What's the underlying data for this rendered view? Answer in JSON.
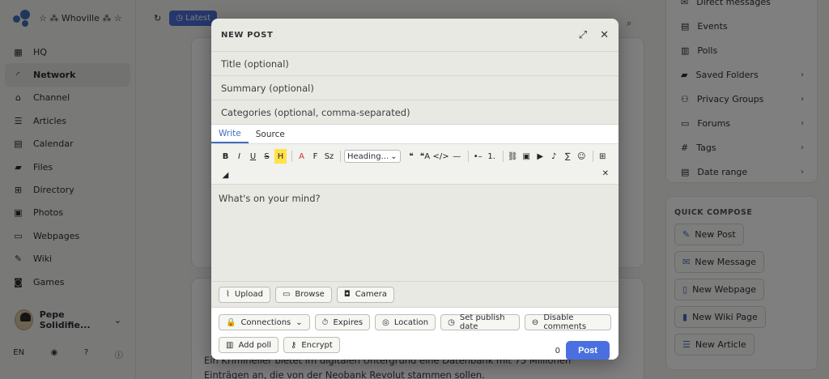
{
  "hub": {
    "name": "☆ ⁂ Whoville ⁂ ☆"
  },
  "nav": [
    {
      "label": "HQ",
      "icon": "dashboard-icon"
    },
    {
      "label": "Network",
      "icon": "rss-icon",
      "active": true
    },
    {
      "label": "Channel",
      "icon": "home-icon"
    },
    {
      "label": "Articles",
      "icon": "articles-icon"
    },
    {
      "label": "Calendar",
      "icon": "calendar-icon"
    },
    {
      "label": "Files",
      "icon": "folder-icon"
    },
    {
      "label": "Directory",
      "icon": "directory-icon"
    },
    {
      "label": "Photos",
      "icon": "image-icon"
    },
    {
      "label": "Webpages",
      "icon": "webpage-icon"
    },
    {
      "label": "Wiki",
      "icon": "wiki-icon"
    },
    {
      "label": "Games",
      "icon": "gamepad-icon"
    }
  ],
  "profile": {
    "name": "Pepe Solidifie..."
  },
  "footer": {
    "lang": "EN"
  },
  "feed": {
    "latest_label": "Latest",
    "snippet": "Ein Krimineller bietet im digitalen Untergrund eine Datenbank mit 75 Millionen Einträgen an, die von der Neobank Revolut stammen sollen."
  },
  "right_menu": [
    {
      "label": "Direct messages",
      "icon": "mail-icon"
    },
    {
      "label": "Events",
      "icon": "calendar-icon"
    },
    {
      "label": "Polls",
      "icon": "poll-icon"
    },
    {
      "label": "Saved Folders",
      "icon": "folder-icon",
      "chevron": true
    },
    {
      "label": "Privacy Groups",
      "icon": "group-icon",
      "chevron": true
    },
    {
      "label": "Forums",
      "icon": "forum-icon",
      "chevron": true
    },
    {
      "label": "Tags",
      "icon": "hash-icon",
      "chevron": true
    },
    {
      "label": "Date range",
      "icon": "calendar-icon",
      "chevron": true
    }
  ],
  "quick_compose": {
    "title": "QUICK COMPOSE",
    "buttons": [
      "New Post",
      "New Message",
      "New Webpage",
      "New Wiki Page",
      "New Article"
    ]
  },
  "modal": {
    "title": "NEW POST",
    "title_placeholder": "Title (optional)",
    "summary_placeholder": "Summary (optional)",
    "categories_placeholder": "Categories (optional, comma-separated)",
    "tabs": [
      "Write",
      "Source"
    ],
    "heading_select": "Heading...",
    "body_placeholder": "What's on your mind?",
    "attach": {
      "upload": "Upload",
      "browse": "Browse",
      "camera": "Camera"
    },
    "options": {
      "connections": "Connections",
      "expires": "Expires",
      "location": "Location",
      "publish_date": "Set publish date",
      "disable_comments": "Disable comments",
      "add_poll": "Add poll",
      "encrypt": "Encrypt"
    },
    "char_count": "0",
    "post_label": "Post"
  },
  "colors": {
    "accent": "#4a6fe0",
    "highlight": "#ffe34a",
    "text_red": "#d0312d"
  }
}
